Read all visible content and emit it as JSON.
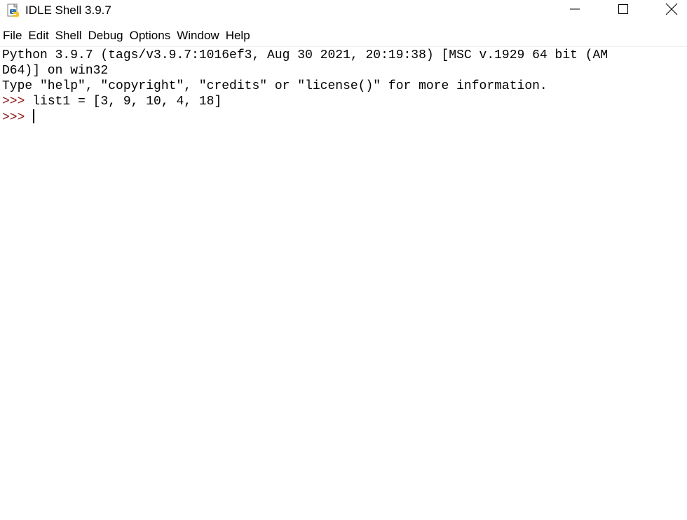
{
  "window": {
    "title": "IDLE Shell 3.9.7",
    "icon": "python-idle-icon",
    "controls": {
      "minimize_icon": "minimize-icon",
      "maximize_icon": "maximize-icon",
      "close_icon": "close-icon"
    }
  },
  "menubar": {
    "items": [
      "File",
      "Edit",
      "Shell",
      "Debug",
      "Options",
      "Window",
      "Help"
    ]
  },
  "shell": {
    "banner_line1": "Python 3.9.7 (tags/v3.9.7:1016ef3, Aug 30 2021, 20:19:38) [MSC v.1929 64 bit (AM",
    "banner_line2": "D64)] on win32",
    "banner_line3": "Type \"help\", \"copyright\", \"credits\" or \"license()\" for more information.",
    "prompt": ">>> ",
    "command1": "list1 = [3, 9, 10, 4, 18]",
    "current_input": ""
  },
  "colors": {
    "prompt": "#8b1a1a",
    "text": "#000000",
    "background": "#ffffff"
  }
}
